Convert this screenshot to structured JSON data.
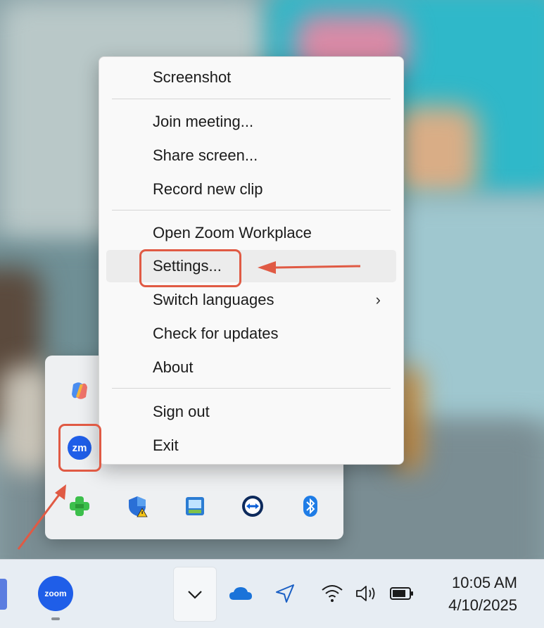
{
  "menu": {
    "items": [
      {
        "label": "Screenshot"
      },
      {
        "label": "Join meeting..."
      },
      {
        "label": "Share screen..."
      },
      {
        "label": "Record new clip"
      },
      {
        "label": "Open Zoom Workplace"
      },
      {
        "label": "Settings..."
      },
      {
        "label": "Switch languages"
      },
      {
        "label": "Check for updates"
      },
      {
        "label": "About"
      },
      {
        "label": "Sign out"
      },
      {
        "label": "Exit"
      }
    ],
    "submenu_chevron": "›"
  },
  "tray_icons": [
    "copilot-icon",
    "zoom-tray-icon",
    "app-green-cross-icon",
    "windows-security-warning-icon",
    "network-tool-icon",
    "teamviewer-icon",
    "bluetooth-icon"
  ],
  "zoom_tray_label": "zm",
  "taskbar": {
    "zoom_app_label": "zoom",
    "tray_expand": "chevron-down-icon",
    "clock_time": "10:05 AM",
    "clock_date": "4/10/2025"
  },
  "annotation_color": "#e05a44"
}
